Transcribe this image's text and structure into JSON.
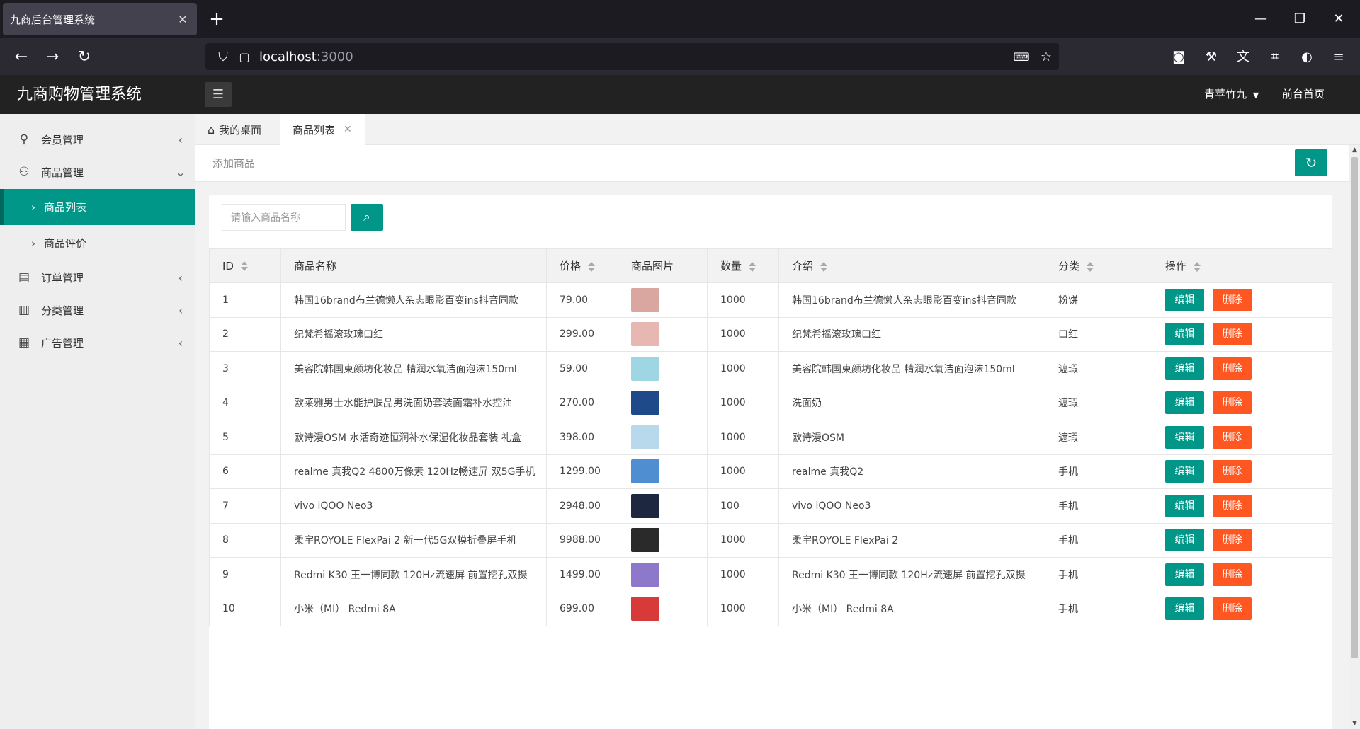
{
  "browser": {
    "tab_title": "九商后台管理系统",
    "tab_close": "✕",
    "new_tab": "+",
    "url_host": "localhost",
    "url_port": ":3000"
  },
  "header": {
    "logo": "九商购物管理系统",
    "user": "青苹竹九",
    "front_link": "前台首页"
  },
  "sidebar": {
    "items": [
      {
        "label": "会员管理"
      },
      {
        "label": "商品管理"
      },
      {
        "label": "订单管理"
      },
      {
        "label": "分类管理"
      },
      {
        "label": "广告管理"
      }
    ],
    "sub_items": [
      {
        "label": "商品列表"
      },
      {
        "label": "商品评价"
      }
    ]
  },
  "page_tabs": [
    {
      "label": "我的桌面"
    },
    {
      "label": "商品列表"
    }
  ],
  "toolbar": {
    "breadcrumb": "添加商品"
  },
  "search": {
    "placeholder": "请输入商品名称"
  },
  "table": {
    "headers": [
      "ID",
      "商品名称",
      "价格",
      "商品图片",
      "数量",
      "介绍",
      "分类",
      "操作"
    ],
    "edit_label": "编辑",
    "delete_label": "删除",
    "rows": [
      {
        "id": "1",
        "name": "韩国16brand布兰德懒人杂志眼影百变ins抖音同款",
        "price": "79.00",
        "qty": "1000",
        "intro": "韩国16brand布兰德懒人杂志眼影百变ins抖音同款",
        "category": "粉饼",
        "thumb_color": "#d9a6a0"
      },
      {
        "id": "2",
        "name": "纪梵希摇滚玫瑰口红",
        "price": "299.00",
        "qty": "1000",
        "intro": "纪梵希摇滚玫瑰口红",
        "category": "口红",
        "thumb_color": "#e7b7b2"
      },
      {
        "id": "3",
        "name": "美容院韩国東颜坊化妆品 精润水氧洁面泡沫150ml",
        "price": "59.00",
        "qty": "1000",
        "intro": "美容院韩国東颜坊化妆品 精润水氧洁面泡沫150ml",
        "category": "遮瑕",
        "thumb_color": "#9fd6e3"
      },
      {
        "id": "4",
        "name": "欧莱雅男士水能护肤品男洗面奶套装面霜补水控油",
        "price": "270.00",
        "qty": "1000",
        "intro": "洗面奶",
        "category": "遮瑕",
        "thumb_color": "#1f4a8a"
      },
      {
        "id": "5",
        "name": "欧诗漫OSM 水活奇迹恒润补水保湿化妆品套装 礼盒",
        "price": "398.00",
        "qty": "1000",
        "intro": "欧诗漫OSM",
        "category": "遮瑕",
        "thumb_color": "#b8d8ec"
      },
      {
        "id": "6",
        "name": "realme 真我Q2 4800万像素 120Hz畅速屏 双5G手机",
        "price": "1299.00",
        "qty": "1000",
        "intro": "realme 真我Q2",
        "category": "手机",
        "thumb_color": "#4f8fd1"
      },
      {
        "id": "7",
        "name": "vivo iQOO Neo3",
        "price": "2948.00",
        "qty": "100",
        "intro": "vivo iQOO Neo3",
        "category": "手机",
        "thumb_color": "#1d2740"
      },
      {
        "id": "8",
        "name": "柔宇ROYOLE FlexPai 2 新一代5G双模折叠屏手机",
        "price": "9988.00",
        "qty": "1000",
        "intro": "柔宇ROYOLE FlexPai 2",
        "category": "手机",
        "thumb_color": "#2a2a2a"
      },
      {
        "id": "9",
        "name": "Redmi K30 王一博同款 120Hz流速屏 前置挖孔双摄",
        "price": "1499.00",
        "qty": "1000",
        "intro": "Redmi K30 王一博同款 120Hz流速屏 前置挖孔双摄",
        "category": "手机",
        "thumb_color": "#8e78c9"
      },
      {
        "id": "10",
        "name": "小米（MI） Redmi 8A",
        "price": "699.00",
        "qty": "1000",
        "intro": "小米（MI） Redmi 8A",
        "category": "手机",
        "thumb_color": "#d83a3a"
      }
    ]
  },
  "colors": {
    "accent": "#009688",
    "danger": "#ff5722",
    "header_bg": "#222222"
  }
}
